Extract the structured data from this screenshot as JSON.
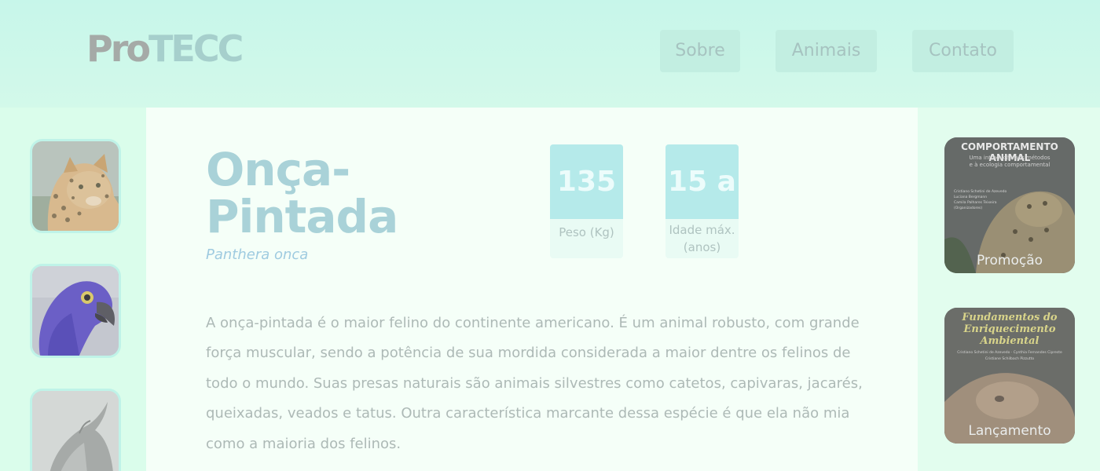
{
  "header": {
    "logo_part1": "Pro",
    "logo_part2": "TECC",
    "nav": [
      "Sobre",
      "Animais",
      "Contato"
    ]
  },
  "sidebar": {
    "thumbnails": [
      "jaguar-thumbnail",
      "macaw-thumbnail",
      "whale-thumbnail"
    ]
  },
  "animal": {
    "name_line1": "Onça-",
    "name_line2": "Pintada",
    "scientific_name": "Panthera onca",
    "stats": [
      {
        "value": "135",
        "label": "Peso (Kg)"
      },
      {
        "value": "15 a",
        "label_line1": "Idade máx.",
        "label_line2": "(anos)"
      }
    ],
    "description": "A onça-pintada é o maior felino do continente americano. É um animal robusto, com grande força muscular, sendo a potência de sua mordida considerada a maior dentre os felinos de todo o mundo. Suas presas naturais são animais silvestres como catetos, capivaras, jacarés, queixadas, veados e tatus. Outra característica marcante dessa espécie é que ela não mia como a maioria dos felinos."
  },
  "books": [
    {
      "title": "COMPORTAMENTO ANIMAL",
      "subtitle_line1": "Uma introdução aos métodos",
      "subtitle_line2": "e à ecologia comportamental",
      "authors": [
        "Cristiano Schetini de Azevedo",
        "Luciana Bergmann",
        "Camila Palhares Teixeira",
        "(Organizadores)"
      ],
      "label": "Promoção"
    },
    {
      "title_line1": "Fundamentos do",
      "title_line2": "Enriquecimento",
      "title_line3": "Ambiental",
      "authors_line1": "Cristiano Schetini de Azevedo · Cynthia Fernandes Cipreste",
      "authors_line2": "Cristiane Schilbach Pizzutto",
      "label": "Lançamento"
    }
  ],
  "colors": {
    "header_bg": "#c7f6ea",
    "accent": "#b5eaea",
    "title": "#a9d2d8",
    "text": "#adb9b6"
  }
}
